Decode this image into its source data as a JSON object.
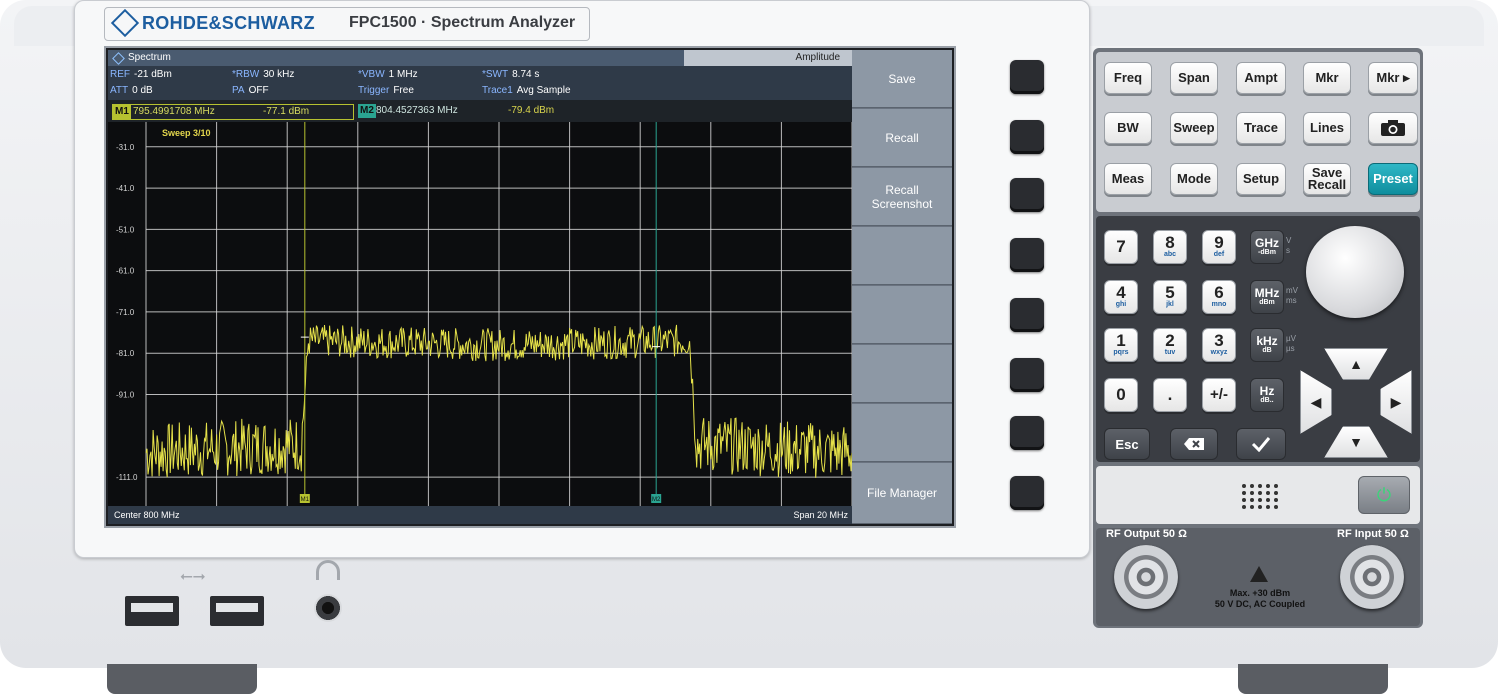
{
  "device": {
    "brand": "ROHDE&SCHWARZ",
    "model": "FPC1500 · Spectrum Analyzer"
  },
  "screen": {
    "tab_title": "Spectrum",
    "amplitude_tab": "Amplitude",
    "params": {
      "ref_label": "REF",
      "ref_value": "-21 dBm",
      "att_label": "ATT",
      "att_value": "0 dB",
      "rbw_label": "*RBW",
      "rbw_value": "30 kHz",
      "pa_label": "PA",
      "pa_value": "OFF",
      "vbw_label": "*VBW",
      "vbw_value": "1 MHz",
      "trigger_label": "Trigger",
      "trigger_value": "Free",
      "swt_label": "*SWT",
      "swt_value": "8.74 s",
      "trace_label": "Trace1",
      "trace_value": "Avg Sample"
    },
    "marker1": {
      "tag": "M1",
      "freq": "795.4991708 MHz",
      "level": "-77.1 dBm"
    },
    "marker2": {
      "tag": "M2",
      "freq": "804.4527363 MHz",
      "level": "-79.4 dBm"
    },
    "sweep_status": "Sweep 3/10",
    "center": "Center 800 MHz",
    "span": "Span 20 MHz",
    "softkeys": [
      "Save",
      "Recall",
      "Recall\nScreenshot",
      "",
      "",
      "",
      "",
      "File Manager"
    ]
  },
  "chart_data": {
    "type": "line",
    "x_center_mhz": 800,
    "x_span_mhz": 20,
    "x": [
      790,
      794.4,
      794.6,
      800,
      805.4,
      805.6,
      810
    ],
    "y": [
      -105,
      -103,
      -78,
      -79,
      -78,
      -103,
      -105
    ],
    "ylabel_ticks": [
      "-31.0",
      "-41.0",
      "-51.0",
      "-61.0",
      "-71.0",
      "-81.0",
      "-91.0",
      "-111.0"
    ],
    "ytick_values": [
      -31,
      -41,
      -51,
      -61,
      -71,
      -81,
      -91,
      -111
    ],
    "ylim": [
      -118,
      -25
    ],
    "grid": true,
    "markers": [
      {
        "label": "M1",
        "x": 794.4991708,
        "y": -77.1,
        "color": "#b7c230"
      },
      {
        "label": "M2",
        "x": 804.4527363,
        "y": -79.4,
        "color": "#2aa491"
      }
    ],
    "trace_color": "#e6e24a"
  },
  "keys": {
    "row1": [
      "Freq",
      "Span",
      "Ampt",
      "Mkr",
      "Mkr ▸"
    ],
    "row2": [
      "BW",
      "Sweep",
      "Trace",
      "Lines"
    ],
    "row3": [
      "Meas",
      "Mode",
      "Setup",
      "Save\nRecall",
      "Preset"
    ],
    "num": [
      {
        "d": "7",
        "s": ""
      },
      {
        "d": "8",
        "s": "abc"
      },
      {
        "d": "9",
        "s": "def"
      },
      {
        "d": "4",
        "s": "ghi"
      },
      {
        "d": "5",
        "s": "jkl"
      },
      {
        "d": "6",
        "s": "mno"
      },
      {
        "d": "1",
        "s": "pqrs"
      },
      {
        "d": "2",
        "s": "tuv"
      },
      {
        "d": "3",
        "s": "wxyz"
      },
      {
        "d": "0",
        "s": ""
      },
      {
        "d": ".",
        "s": ""
      },
      {
        "d": "+/-",
        "s": ""
      }
    ],
    "units": [
      {
        "u": "GHz",
        "s": "-dBm",
        "n": "V\ns"
      },
      {
        "u": "MHz",
        "s": "dBm",
        "n": "mV\nms"
      },
      {
        "u": "kHz",
        "s": "dB",
        "n": "µV\nµs"
      },
      {
        "u": "Hz",
        "s": "dB..",
        "n": ""
      }
    ],
    "esc": "Esc"
  },
  "rf": {
    "output": "RF Output 50 Ω",
    "input": "RF Input 50 Ω",
    "warning_line1": "Max. +30 dBm",
    "warning_line2": "50 V DC, AC Coupled"
  }
}
